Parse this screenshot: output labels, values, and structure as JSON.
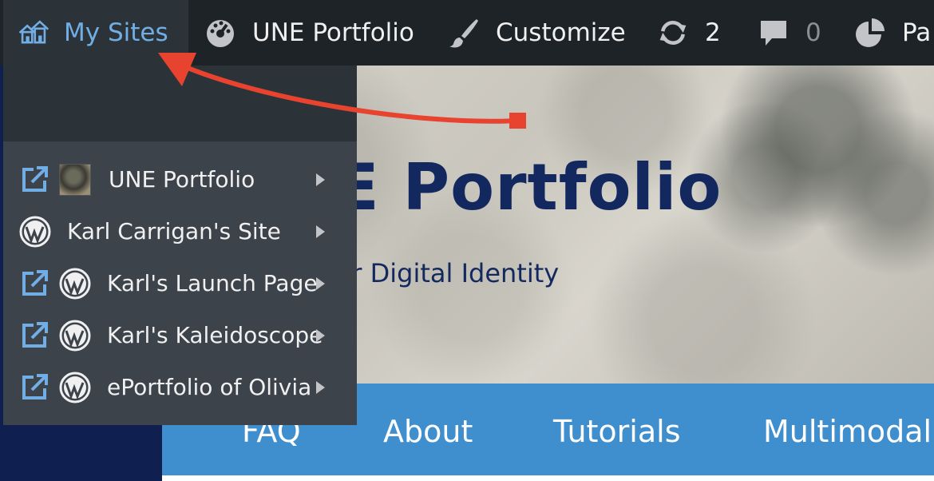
{
  "admin_bar": {
    "my_sites": "My Sites",
    "site_name": "UNE Portfolio",
    "customize": "Customize",
    "updates_count": "2",
    "comments_count": "0",
    "stats_partial": "Pa"
  },
  "my_sites_menu": [
    {
      "label": "UNE Portfolio",
      "icon": "site-thumbnail",
      "external": true
    },
    {
      "label": "Karl Carrigan's Site",
      "icon": "wordpress-logo",
      "external": false
    },
    {
      "label": "Karl's Launch Page",
      "icon": "wordpress-logo",
      "external": true
    },
    {
      "label": "Karl's Kaleidoscope",
      "icon": "wordpress-logo",
      "external": true
    },
    {
      "label": "ePortfolio of Olivia",
      "icon": "wordpress-logo",
      "external": true
    }
  ],
  "hero": {
    "title_visible": "E Portfolio",
    "subtitle_visible": "ur Digital Identity"
  },
  "nav": [
    "FAQ",
    "About",
    "Tutorials",
    "Multimodal"
  ],
  "colors": {
    "admin_bar_bg": "#1d2327",
    "menu_bg": "#3c434a",
    "accent_blue": "#72aee6",
    "nav_bg": "#3f8fcf",
    "title_navy": "#13285e",
    "annotation_red": "#e8432e"
  }
}
